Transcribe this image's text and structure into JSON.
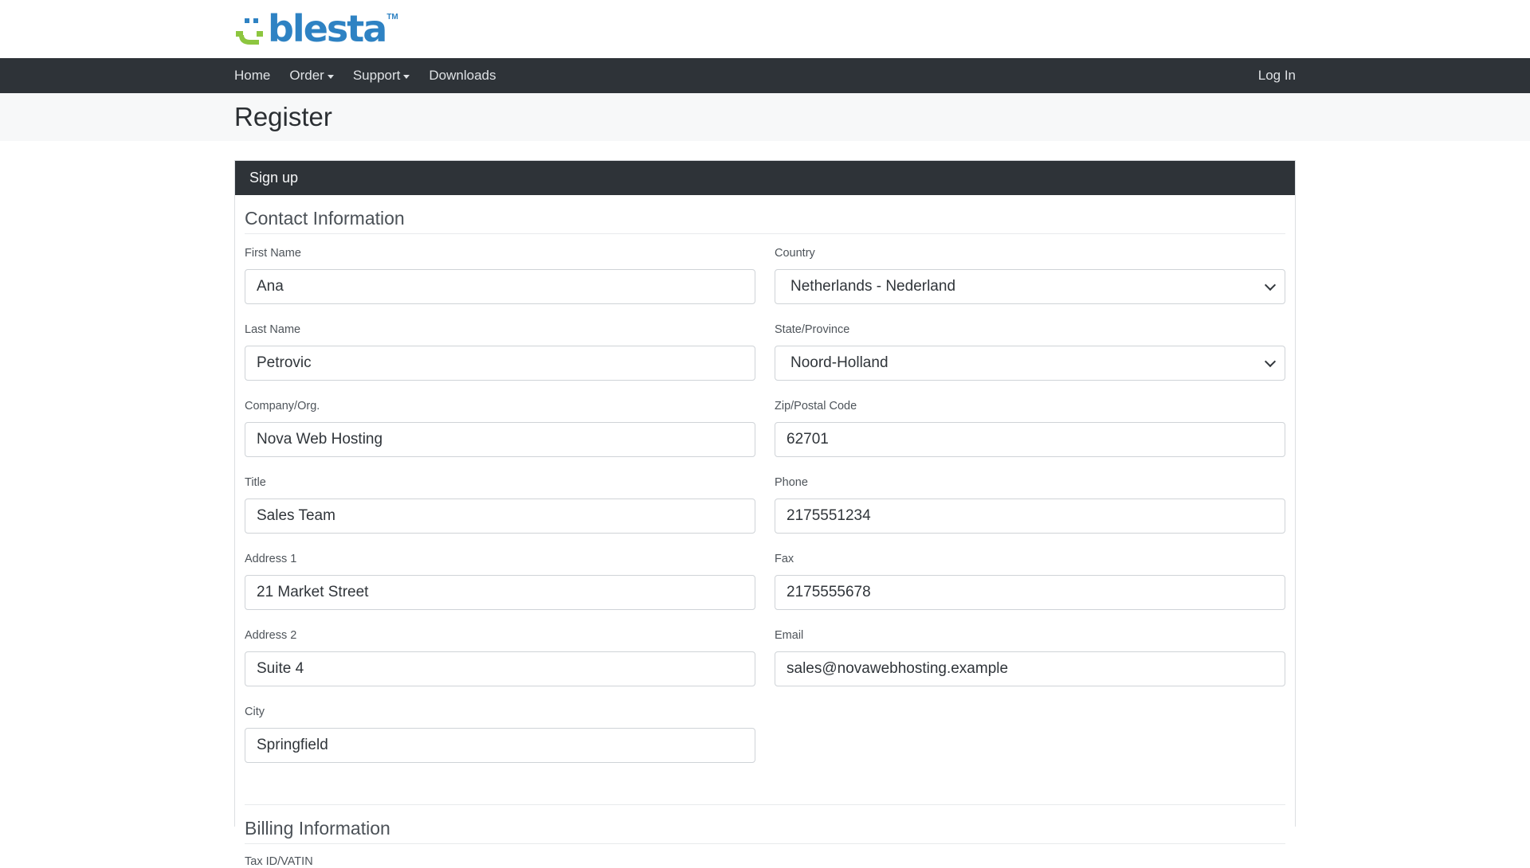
{
  "brand": {
    "logo_text": "blesta",
    "trademark": "TM",
    "colors": {
      "green": "#8dc63f",
      "blue": "#2e82c3"
    }
  },
  "nav": {
    "items": [
      {
        "label": "Home",
        "dropdown": false
      },
      {
        "label": "Order",
        "dropdown": true
      },
      {
        "label": "Support",
        "dropdown": true
      },
      {
        "label": "Downloads",
        "dropdown": false
      }
    ],
    "login_label": "Log In"
  },
  "page": {
    "title": "Register"
  },
  "card": {
    "header": "Sign up"
  },
  "contact": {
    "section_title": "Contact Information",
    "first_name": {
      "label": "First Name",
      "value": "Ana"
    },
    "last_name": {
      "label": "Last Name",
      "value": "Petrovic"
    },
    "company": {
      "label": "Company/Org.",
      "value": "Nova Web Hosting"
    },
    "title": {
      "label": "Title",
      "value": "Sales Team"
    },
    "address1": {
      "label": "Address 1",
      "value": "21 Market Street"
    },
    "address2": {
      "label": "Address 2",
      "value": "Suite 4"
    },
    "city": {
      "label": "City",
      "value": "Springfield"
    },
    "country": {
      "label": "Country",
      "value": "Netherlands - Nederland"
    },
    "state": {
      "label": "State/Province",
      "value": "Noord-Holland"
    },
    "zip": {
      "label": "Zip/Postal Code",
      "value": "62701"
    },
    "phone": {
      "label": "Phone",
      "value": "2175551234"
    },
    "fax": {
      "label": "Fax",
      "value": "2175555678"
    },
    "email": {
      "label": "Email",
      "value": "sales@novawebhosting.example"
    }
  },
  "billing": {
    "section_title": "Billing Information",
    "tax_id_label": "Tax ID/VATIN"
  }
}
